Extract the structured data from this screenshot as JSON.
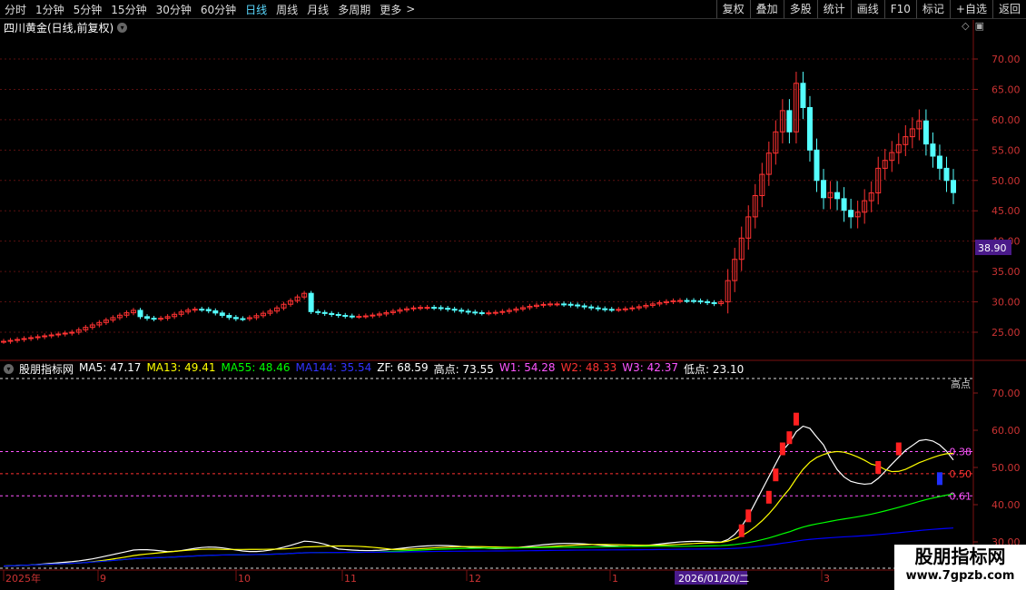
{
  "toolbar": {
    "timeframes": [
      "分时",
      "1分钟",
      "5分钟",
      "15分钟",
      "30分钟",
      "60分钟",
      "日线",
      "周线",
      "月线",
      "多周期",
      "更多"
    ],
    "active_index": 6,
    "more_chevron": ">",
    "right_buttons": [
      "复权",
      "叠加",
      "多股",
      "统计",
      "画线",
      "F10",
      "标记",
      "+自选",
      "返回"
    ]
  },
  "chart": {
    "title": "四川黄金(日线,前复权)",
    "price_ticks": [
      "70.00",
      "65.00",
      "60.00",
      "55.00",
      "50.00",
      "45.00",
      "40.00",
      "35.00",
      "30.00",
      "25.00"
    ],
    "current_price_label": "38.90",
    "indicator_ticks": [
      "70.00",
      "60.00",
      "50.00",
      "40.00",
      "30.00"
    ],
    "level_labels": [
      "0.38",
      "0.50",
      "0.61"
    ],
    "high_label": "高点",
    "date_axis": [
      "2025年",
      "9",
      "10",
      "11",
      "12",
      "1",
      "2026/01/20/二",
      "3"
    ],
    "colors": {
      "up": "#ff3232",
      "down": "#54ffff",
      "ma5": "#ffffff",
      "ma13": "#ffff00",
      "ma55": "#00ff00",
      "ma144": "#0000ff",
      "w1": "#ff55ff",
      "w2": "#ff3232",
      "w3": "#ff55ff"
    }
  },
  "indicator": {
    "name": "股朋指标网",
    "items": [
      {
        "label": "MA5: 47.17",
        "color": "#ffffff"
      },
      {
        "label": "MA13: 49.41",
        "color": "#ffff00"
      },
      {
        "label": "MA55: 48.46",
        "color": "#00ff00"
      },
      {
        "label": "MA144: 35.54",
        "color": "#3333ff"
      },
      {
        "label": "ZF: 68.59",
        "color": "#ffffff"
      },
      {
        "label": "高点: 73.55",
        "color": "#ffffff"
      },
      {
        "label": "W1: 54.28",
        "color": "#ff55ff"
      },
      {
        "label": "W2: 48.33",
        "color": "#ff3232"
      },
      {
        "label": "W3: 42.37",
        "color": "#ff55ff"
      },
      {
        "label": "低点: 23.10",
        "color": "#ffffff"
      }
    ]
  },
  "watermark": {
    "line1": "股朋指标网",
    "line2": "www.7gpzb.com"
  }
}
